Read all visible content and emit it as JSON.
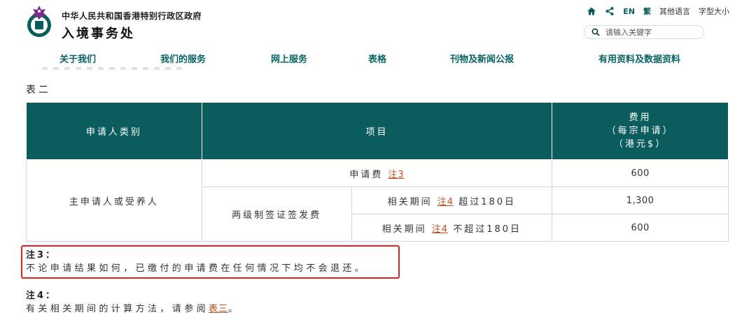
{
  "header": {
    "org_name": "中华人民共和国香港特别行政区政府",
    "dept_name": "入境事务处",
    "lang_en": "EN",
    "lang_trad": "繁",
    "other_langs": "其他语言",
    "font_size": "字型大小",
    "search_placeholder": "请输入关键字"
  },
  "nav": {
    "items": [
      "关于我们",
      "我们的服务",
      "网上服务",
      "表格",
      "刊物及新闻公报",
      "有用资料及数据资料"
    ]
  },
  "table": {
    "title": "表二",
    "headers": {
      "category": "申请人类别",
      "item": "项目",
      "fee_line1": "费用",
      "fee_line2": "（每宗申请）",
      "fee_line3": "（港元$）"
    },
    "category": "主申请人或受养人",
    "application_fee_label": "申请费",
    "note3_link": "注3",
    "visa_fee_label": "两级制签证签发费",
    "period_label": "相关期间",
    "note4_link": "注4",
    "over_180": "超过180日",
    "not_over_180": "不超过180日",
    "fees": [
      "600",
      "1,300",
      "600"
    ]
  },
  "notes": {
    "note3_label": "注3：",
    "note3_text": "不论申请结果如何，已缴付的申请费在任何情况下均不会退还。",
    "note4_label": "注4：",
    "note4_text_before": "有关相关期间的计算方法，请参阅",
    "note4_link": "表三",
    "note4_text_after": "。"
  },
  "colors": {
    "header_teal": "#0b5c5c",
    "link_orange": "#c0501f",
    "highlight_red": "#e52020"
  }
}
